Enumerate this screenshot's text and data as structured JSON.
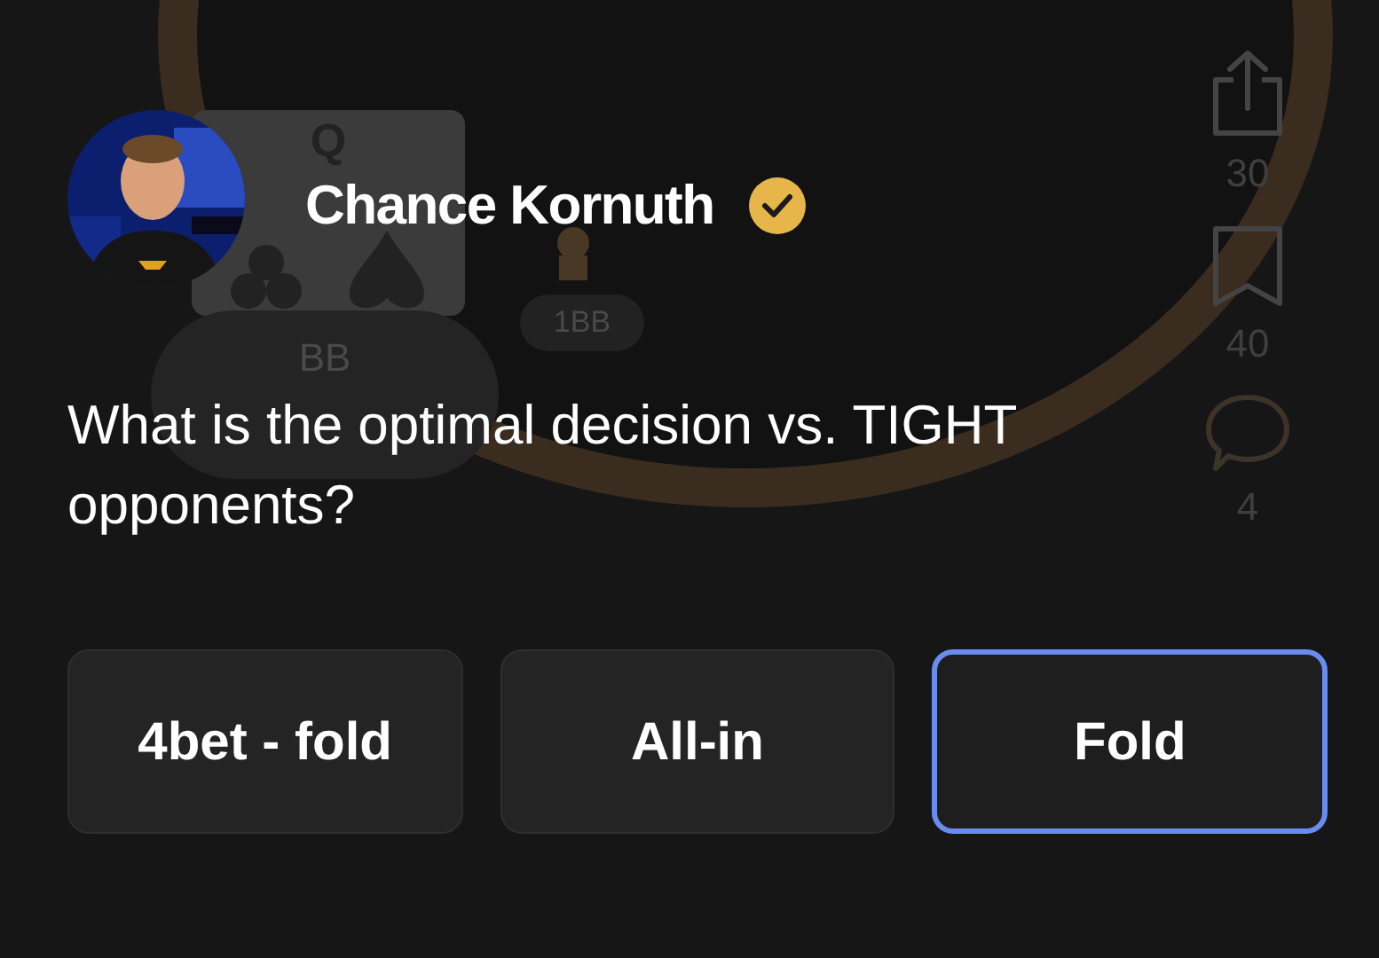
{
  "table": {
    "card_rank": "Q",
    "seat_label": "BB",
    "bet": "1BB"
  },
  "author": {
    "name": "Chance Kornuth",
    "verified": true
  },
  "question": "What is the optimal decision vs. TIGHT opponents?",
  "actions": [
    {
      "kind": "share",
      "count": "30"
    },
    {
      "kind": "bookmark",
      "count": "40"
    },
    {
      "kind": "comment",
      "count": "4"
    }
  ],
  "answers": [
    {
      "label": "4bet - fold",
      "selected": false
    },
    {
      "label": "All-in",
      "selected": false
    },
    {
      "label": "Fold",
      "selected": true
    }
  ]
}
